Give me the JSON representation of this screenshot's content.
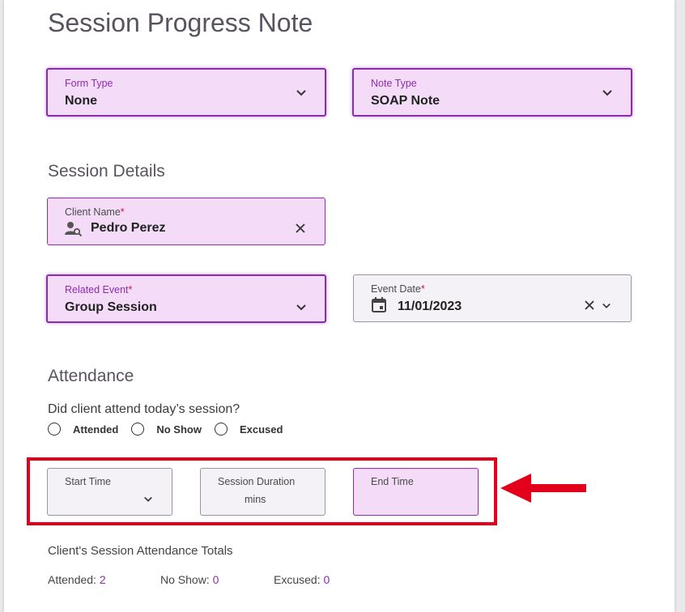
{
  "page": {
    "title": "Session Progress Note"
  },
  "form_type": {
    "label": "Form Type",
    "value": "None"
  },
  "note_type": {
    "label": "Note Type",
    "value": "SOAP Note"
  },
  "session_details": {
    "heading": "Session Details",
    "client_name": {
      "label": "Client Name",
      "required": "*",
      "value": "Pedro Perez"
    },
    "related_event": {
      "label": "Related Event",
      "required": "*",
      "value": "Group Session"
    },
    "event_date": {
      "label": "Event Date",
      "required": "*",
      "value": "11/01/2023"
    }
  },
  "attendance": {
    "heading": "Attendance",
    "question": "Did client attend today’s session?",
    "options": [
      "Attended",
      "No Show",
      "Excused"
    ],
    "start_time": {
      "label": "Start Time",
      "value": ""
    },
    "session_duration": {
      "label": "Session Duration",
      "unit": "mins"
    },
    "end_time": {
      "label": "End Time",
      "value": ""
    }
  },
  "totals": {
    "heading": "Client's Session Attendance Totals",
    "attended_label": "Attended:",
    "attended_value": "2",
    "no_show_label": "No Show:",
    "no_show_value": "0",
    "excused_label": "Excused:",
    "excused_value": "0"
  },
  "colors": {
    "accent": "#8e2bb0",
    "field_highlight": "#f4dcf9",
    "annotation_red": "#e3001b"
  },
  "icons": [
    "chevron-down-icon",
    "person-search-icon",
    "close-icon",
    "calendar-icon",
    "arrow-left-icon"
  ]
}
